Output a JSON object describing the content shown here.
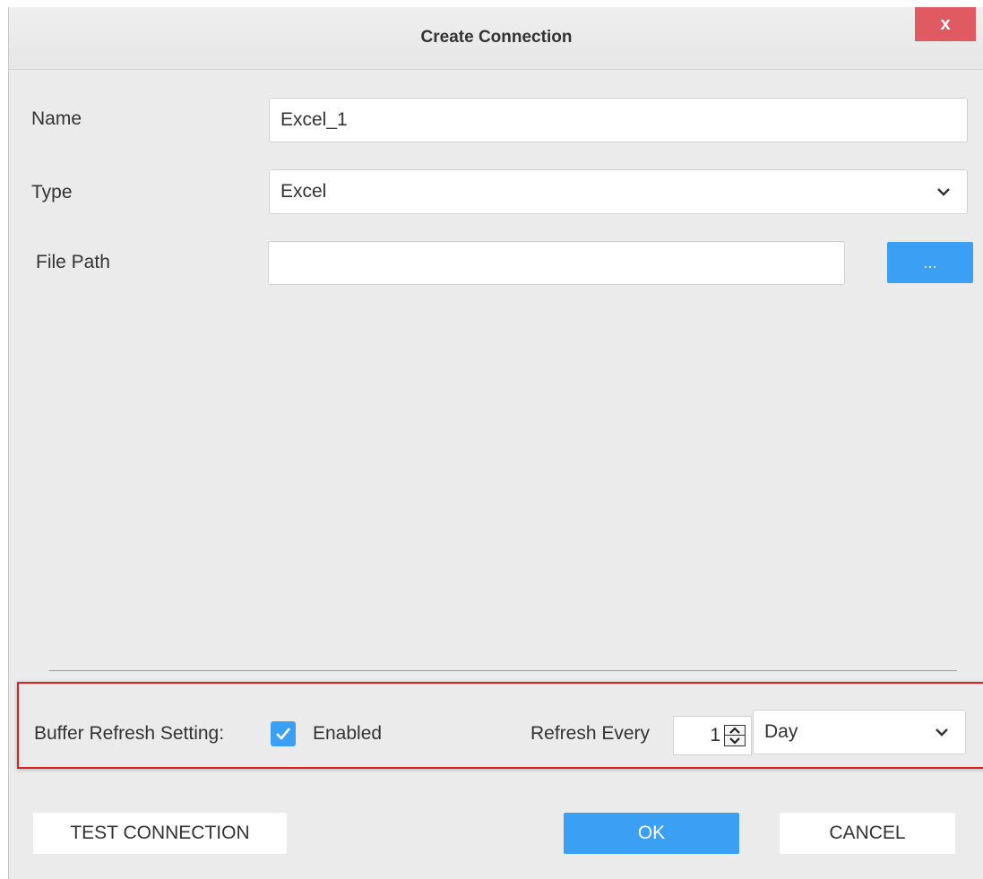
{
  "dialog": {
    "title": "Create Connection",
    "close_label": "x"
  },
  "form": {
    "name_label": "Name",
    "name_value": "Excel_1",
    "type_label": "Type",
    "type_value": "Excel",
    "file_path_label": "File Path",
    "file_path_value": "",
    "browse_label": "..."
  },
  "buffer": {
    "label": "Buffer Refresh Setting:",
    "enabled_checked": true,
    "enabled_label": "Enabled",
    "refresh_every_label": "Refresh Every",
    "interval_value": "1",
    "unit_value": "Day"
  },
  "footer": {
    "test_connection_label": "TEST CONNECTION",
    "ok_label": "OK",
    "cancel_label": "CANCEL"
  },
  "colors": {
    "accent": "#3b9ff3",
    "close": "#e05a61",
    "highlight_border": "#e02020",
    "background": "#ebebeb"
  },
  "icons": {
    "dropdown": "chevron-down-icon",
    "checkbox": "checkmark-icon",
    "spinner_up": "caret-up-icon",
    "spinner_down": "caret-down-icon"
  }
}
